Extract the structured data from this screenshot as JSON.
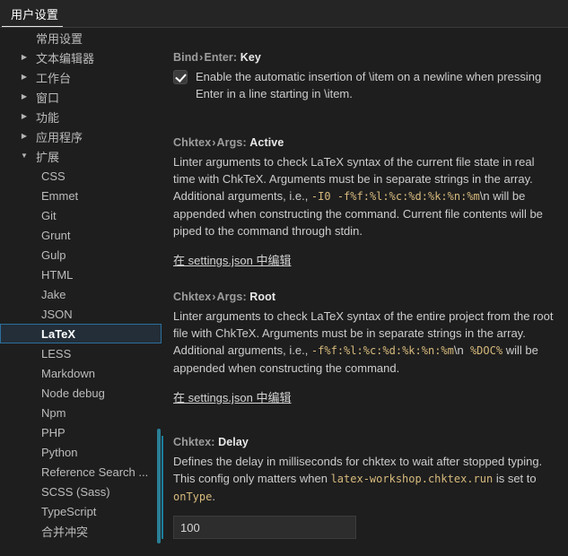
{
  "window": {
    "tab_label": "用户设置"
  },
  "sidebar": {
    "items": [
      {
        "label": "常用设置",
        "twisty": "none",
        "level": 0,
        "selected": false
      },
      {
        "label": "文本编辑器",
        "twisty": "collapsed",
        "level": 0,
        "selected": false
      },
      {
        "label": "工作台",
        "twisty": "collapsed",
        "level": 0,
        "selected": false
      },
      {
        "label": "窗口",
        "twisty": "collapsed",
        "level": 0,
        "selected": false
      },
      {
        "label": "功能",
        "twisty": "collapsed",
        "level": 0,
        "selected": false
      },
      {
        "label": "应用程序",
        "twisty": "collapsed",
        "level": 0,
        "selected": false
      },
      {
        "label": "扩展",
        "twisty": "expanded",
        "level": 0,
        "selected": false
      },
      {
        "label": "CSS",
        "twisty": "none",
        "level": 1,
        "selected": false
      },
      {
        "label": "Emmet",
        "twisty": "none",
        "level": 1,
        "selected": false
      },
      {
        "label": "Git",
        "twisty": "none",
        "level": 1,
        "selected": false
      },
      {
        "label": "Grunt",
        "twisty": "none",
        "level": 1,
        "selected": false
      },
      {
        "label": "Gulp",
        "twisty": "none",
        "level": 1,
        "selected": false
      },
      {
        "label": "HTML",
        "twisty": "none",
        "level": 1,
        "selected": false
      },
      {
        "label": "Jake",
        "twisty": "none",
        "level": 1,
        "selected": false
      },
      {
        "label": "JSON",
        "twisty": "none",
        "level": 1,
        "selected": false
      },
      {
        "label": "LaTeX",
        "twisty": "none",
        "level": 1,
        "selected": true
      },
      {
        "label": "LESS",
        "twisty": "none",
        "level": 1,
        "selected": false
      },
      {
        "label": "Markdown",
        "twisty": "none",
        "level": 1,
        "selected": false
      },
      {
        "label": "Node debug",
        "twisty": "none",
        "level": 1,
        "selected": false
      },
      {
        "label": "Npm",
        "twisty": "none",
        "level": 1,
        "selected": false
      },
      {
        "label": "PHP",
        "twisty": "none",
        "level": 1,
        "selected": false
      },
      {
        "label": "Python",
        "twisty": "none",
        "level": 1,
        "selected": false
      },
      {
        "label": "Reference Search ...",
        "twisty": "none",
        "level": 1,
        "selected": false
      },
      {
        "label": "SCSS (Sass)",
        "twisty": "none",
        "level": 1,
        "selected": false
      },
      {
        "label": "TypeScript",
        "twisty": "none",
        "level": 1,
        "selected": false
      },
      {
        "label": "合并冲突",
        "twisty": "none",
        "level": 1,
        "selected": false
      }
    ],
    "twisty_glyphs": {
      "collapsed": "▶",
      "expanded": "▼",
      "none": ""
    }
  },
  "settings": {
    "bind_enter_key": {
      "title_prefix": "Bind",
      "title_mid": "Enter",
      "title_leaf": "Key",
      "separator": "›",
      "colon": ":",
      "checked": true,
      "desc_1": "Enable the automatic insertion of ",
      "code_1": "\\item",
      "desc_2": " on a newline when pressing ",
      "code_2": "Enter",
      "desc_3": " in a line starting in ",
      "code_3": "\\item",
      "desc_4": "."
    },
    "chktex_args_active": {
      "title_prefix": "Chktex",
      "title_mid": "Args",
      "title_leaf": "Active",
      "separator": "›",
      "colon": ":",
      "desc_1": "Linter arguments to check LaTeX syntax of the current file state in real time with ChkTeX. Arguments must be in separate strings in the array. Additional arguments, i.e., ",
      "code_1": "-I0 -f%f:%l:%c:%d:%k:%n:%m",
      "code_1_tail": "\\n",
      "desc_2": " will be appended when constructing the command. Current file contents will be piped to the command through stdin.",
      "json_link": "在 settings.json 中编辑"
    },
    "chktex_args_root": {
      "title_prefix": "Chktex",
      "title_mid": "Args",
      "title_leaf": "Root",
      "separator": "›",
      "colon": ":",
      "desc_1": "Linter arguments to check LaTeX syntax of the entire project from the root file with ChkTeX. Arguments must be in separate strings in the array. Additional arguments, i.e., ",
      "code_1": "-f%f:%l:%c:%d:%k:%n:%m",
      "code_1_tail": "\\n",
      "code_1_doc": " %DOC%",
      "desc_2": " will be appended when constructing the command.",
      "json_link": "在 settings.json 中编辑"
    },
    "chktex_delay": {
      "title_prefix": "Chktex",
      "title_leaf": "Delay",
      "colon": ":",
      "desc_1": "Defines the delay in milliseconds for chktex to wait after stopped typing. This config only matters when ",
      "code_1": "latex-workshop.chktex.run",
      "desc_2": " is set to ",
      "code_2": "onType",
      "desc_3": ".",
      "input_value": "100"
    }
  },
  "colors": {
    "background": "#1e1e1e",
    "tabbar_background": "#252526",
    "selected_outline": "#2b6f9c",
    "modified_marker": "#1d7e9c",
    "code_tan": "#d7ba7d",
    "code_orange": "#ce9178",
    "scrollbar": "#2a7f96"
  }
}
